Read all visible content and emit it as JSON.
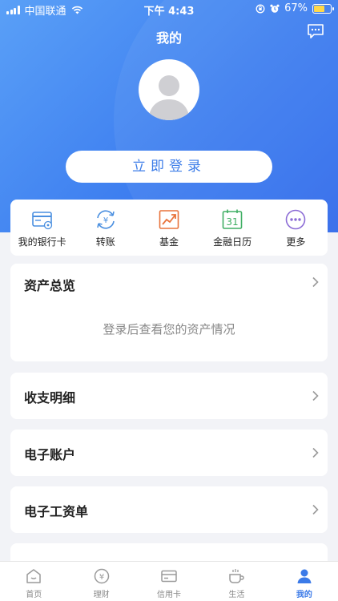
{
  "status_bar": {
    "carrier": "中国联通",
    "time": "下午 4:43",
    "battery": "67%",
    "battery_level": 0.67
  },
  "header": {
    "title": "我的"
  },
  "login": {
    "label": "立即登录"
  },
  "quick_actions": [
    {
      "label": "我的银行卡",
      "icon": "bank-card-icon",
      "color": "#4a8fe0"
    },
    {
      "label": "转账",
      "icon": "transfer-icon",
      "color": "#4a8fe0"
    },
    {
      "label": "基金",
      "icon": "fund-chart-icon",
      "color": "#e8733b"
    },
    {
      "label": "金融日历",
      "icon": "calendar-icon",
      "color": "#3fae63"
    },
    {
      "label": "更多",
      "icon": "more-dots-icon",
      "color": "#8c6cd6"
    }
  ],
  "calendar_day": "31",
  "assets": {
    "title": "资产总览",
    "empty_message": "登录后查看您的资产情况"
  },
  "rows": [
    {
      "label": "收支明细"
    },
    {
      "label": "电子账户"
    },
    {
      "label": "电子工资单"
    }
  ],
  "tabs": [
    {
      "label": "首页",
      "icon": "home-icon",
      "active": false
    },
    {
      "label": "理财",
      "icon": "wealth-icon",
      "active": false
    },
    {
      "label": "信用卡",
      "icon": "credit-card-icon",
      "active": false
    },
    {
      "label": "生活",
      "icon": "coffee-icon",
      "active": false
    },
    {
      "label": "我的",
      "icon": "user-icon",
      "active": true
    }
  ],
  "colors": {
    "accent": "#3b7ae8",
    "header_gradient_start": "#5aa0f7",
    "header_gradient_end": "#2f69ea"
  }
}
